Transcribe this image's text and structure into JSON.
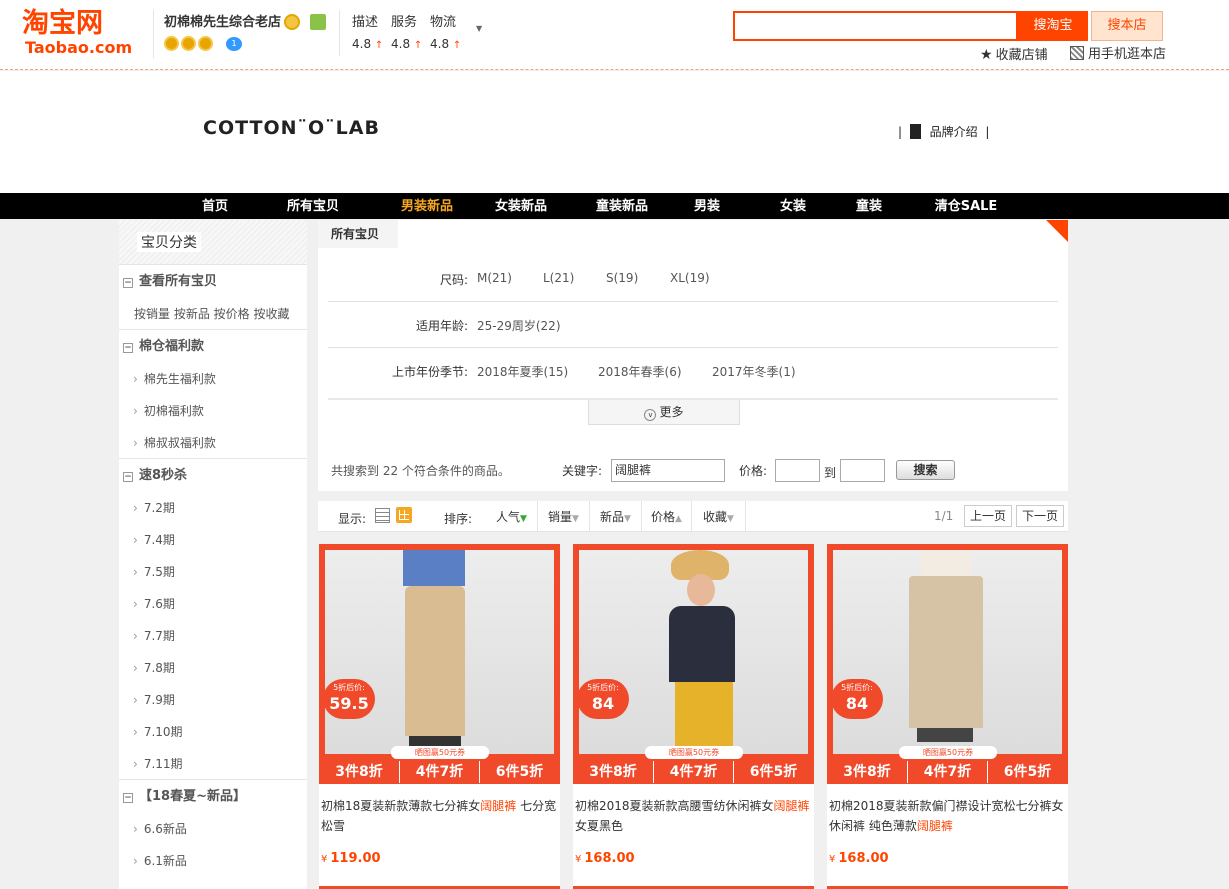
{
  "header": {
    "logo_cn": "淘宝网",
    "logo_en": "Taobao.com",
    "shop_name": "初棉棉先生综合老店",
    "ratings": [
      {
        "label": "描述",
        "value": "4.8"
      },
      {
        "label": "服务",
        "value": "4.8"
      },
      {
        "label": "物流",
        "value": "4.8"
      }
    ],
    "search_taobao": "搜淘宝",
    "search_shop": "搜本店",
    "favorite_shop": "收藏店铺",
    "mobile_shop": "用手机逛本店"
  },
  "banner": {
    "brand": "COTTON¨O¨LAB",
    "brand_intro": "品牌介绍"
  },
  "nav": [
    "首页",
    "所有宝贝",
    "男装新品",
    "女装新品",
    "童装新品",
    "男装",
    "女装",
    "童装",
    "清仓SALE"
  ],
  "nav_active_color": "#f5a623",
  "sidebar": {
    "title": "宝贝分类",
    "view_all": "查看所有宝贝",
    "sort_links": "按销量 按新品 按价格 按收藏",
    "group1": "棉仓福利款",
    "group1_items": [
      "棉先生福利款",
      "初棉福利款",
      "棉叔叔福利款"
    ],
    "group2": "速8秒杀",
    "group2_items": [
      "7.2期",
      "7.4期",
      "7.5期",
      "7.6期",
      "7.7期",
      "7.8期",
      "7.9期",
      "7.10期",
      "7.11期"
    ],
    "group3": "【18春夏~新品】",
    "group3_items": [
      "6.6新品",
      "6.1新品"
    ]
  },
  "filters": {
    "breadcrumb": "所有宝贝",
    "size_label": "尺码:",
    "sizes": [
      "M(21)",
      "L(21)",
      "S(19)",
      "XL(19)"
    ],
    "age_label": "适用年龄:",
    "ages": [
      "25-29周岁(22)"
    ],
    "season_label": "上市年份季节:",
    "seasons": [
      "2018年夏季(15)",
      "2018年春季(6)",
      "2017年冬季(1)"
    ],
    "more": "更多"
  },
  "search": {
    "result_text": "共搜索到 22 个符合条件的商品。",
    "keyword_label": "关键字:",
    "keyword_value": "阔腿裤",
    "price_label": "价格:",
    "to": "到",
    "submit": "搜索"
  },
  "toolbar": {
    "display_label": "显示:",
    "sort_label": "排序:",
    "sorts": [
      "人气",
      "销量",
      "新品",
      "价格",
      "收藏"
    ],
    "page": "1/1",
    "prev": "上一页",
    "next": "下一页"
  },
  "products": [
    {
      "title_pre": "初棉18夏装新款薄款七分裤女",
      "title_hl": "阔腿裤",
      "title_post": " 七分宽松雪",
      "price": "119.00",
      "badge_label": "5折后价:",
      "badge_price": "59.5",
      "ticket": "晒图赢50元券",
      "deals": [
        "3件8折",
        "4件7折",
        "6件5折"
      ]
    },
    {
      "title_pre": "初棉2018夏装新款高腰雪纺休闲裤女",
      "title_hl": "阔腿裤",
      "title_post": "女夏黑色",
      "price": "168.00",
      "badge_label": "5折后价:",
      "badge_price": "84",
      "ticket": "晒图赢50元券",
      "deals": [
        "3件8折",
        "4件7折",
        "6件5折"
      ]
    },
    {
      "title_pre": "初棉2018夏装新款偏门襟设计宽松七分裤女休闲裤 纯色薄款",
      "title_hl": "阔腿裤",
      "title_post": "",
      "price": "168.00",
      "badge_label": "5折后价:",
      "badge_price": "84",
      "ticket": "晒图赢50元券",
      "deals": [
        "3件8折",
        "4件7折",
        "6件5折"
      ]
    }
  ],
  "currency": "¥"
}
